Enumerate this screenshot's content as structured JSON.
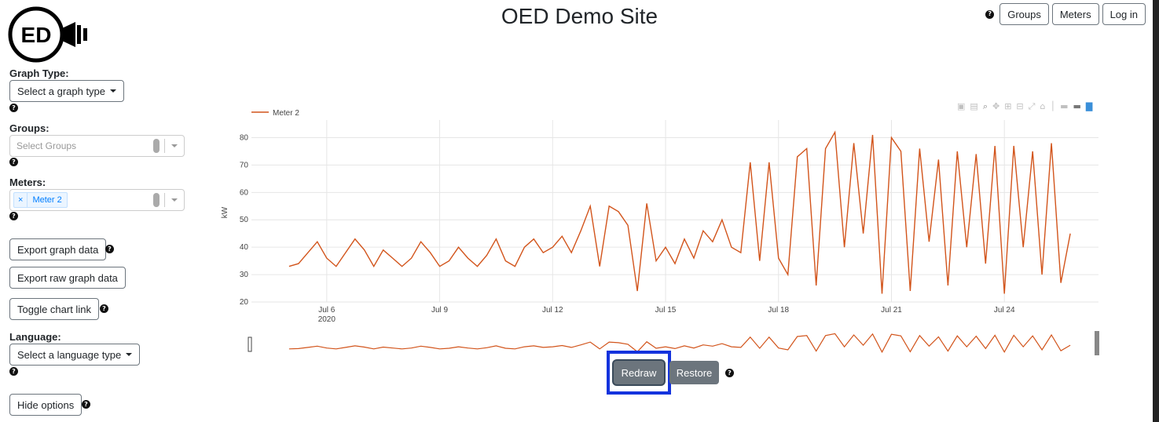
{
  "header": {
    "title": "OED Demo Site",
    "logo_text": "ED",
    "help": "?",
    "nav": [
      "Groups",
      "Meters",
      "Log in"
    ]
  },
  "sidebar": {
    "graph_type_label": "Graph Type:",
    "graph_type_value": "Select a graph type",
    "groups_label": "Groups:",
    "groups_placeholder": "Select Groups",
    "meters_label": "Meters:",
    "meters_selected": [
      "Meter 2"
    ],
    "chip_remove": "×",
    "export_graph": "Export graph data",
    "export_raw": "Export raw graph data",
    "toggle_link": "Toggle chart link",
    "language_label": "Language:",
    "language_value": "Select a language type",
    "hide_options": "Hide options"
  },
  "chart_controls": {
    "redraw": "Redraw",
    "restore": "Restore"
  },
  "colors": {
    "series": "#d2541b",
    "highlight": "#1433dd",
    "button_secondary": "#6c757d"
  },
  "chart_data": {
    "type": "line",
    "ylabel": "kW",
    "ylim": [
      20,
      83
    ],
    "yticks": [
      20,
      30,
      40,
      50,
      60,
      70,
      80
    ],
    "xticks": [
      "Jul 6",
      "Jul 9",
      "Jul 12",
      "Jul 15",
      "Jul 18",
      "Jul 21",
      "Jul 24"
    ],
    "xtick_sublabel": "2020",
    "x_start": "2020-07-04",
    "x_end": "2020-07-26",
    "legend": "top-left",
    "grid": true,
    "series": [
      {
        "name": "Meter 2",
        "color": "#d2541b",
        "points": [
          [
            "2020-07-05 00:00",
            33
          ],
          [
            "2020-07-05 06:00",
            34
          ],
          [
            "2020-07-05 12:00",
            38
          ],
          [
            "2020-07-05 18:00",
            42
          ],
          [
            "2020-07-06 00:00",
            36
          ],
          [
            "2020-07-06 06:00",
            33
          ],
          [
            "2020-07-06 12:00",
            38
          ],
          [
            "2020-07-06 18:00",
            43
          ],
          [
            "2020-07-07 00:00",
            39
          ],
          [
            "2020-07-07 06:00",
            33
          ],
          [
            "2020-07-07 12:00",
            39
          ],
          [
            "2020-07-07 18:00",
            36
          ],
          [
            "2020-07-08 00:00",
            33
          ],
          [
            "2020-07-08 06:00",
            36
          ],
          [
            "2020-07-08 12:00",
            42
          ],
          [
            "2020-07-08 18:00",
            38
          ],
          [
            "2020-07-09 00:00",
            33
          ],
          [
            "2020-07-09 06:00",
            35
          ],
          [
            "2020-07-09 12:00",
            40
          ],
          [
            "2020-07-09 18:00",
            36
          ],
          [
            "2020-07-10 00:00",
            33
          ],
          [
            "2020-07-10 06:00",
            37
          ],
          [
            "2020-07-10 12:00",
            43
          ],
          [
            "2020-07-10 18:00",
            35
          ],
          [
            "2020-07-11 00:00",
            33
          ],
          [
            "2020-07-11 06:00",
            40
          ],
          [
            "2020-07-11 12:00",
            43
          ],
          [
            "2020-07-11 18:00",
            38
          ],
          [
            "2020-07-12 00:00",
            40
          ],
          [
            "2020-07-12 06:00",
            44
          ],
          [
            "2020-07-12 12:00",
            38
          ],
          [
            "2020-07-12 18:00",
            46
          ],
          [
            "2020-07-13 00:00",
            55
          ],
          [
            "2020-07-13 06:00",
            33
          ],
          [
            "2020-07-13 12:00",
            55
          ],
          [
            "2020-07-13 18:00",
            53
          ],
          [
            "2020-07-14 00:00",
            48
          ],
          [
            "2020-07-14 06:00",
            24
          ],
          [
            "2020-07-14 12:00",
            56
          ],
          [
            "2020-07-14 18:00",
            35
          ],
          [
            "2020-07-15 00:00",
            40
          ],
          [
            "2020-07-15 06:00",
            34
          ],
          [
            "2020-07-15 12:00",
            43
          ],
          [
            "2020-07-15 18:00",
            36
          ],
          [
            "2020-07-16 00:00",
            46
          ],
          [
            "2020-07-16 06:00",
            42
          ],
          [
            "2020-07-16 12:00",
            50
          ],
          [
            "2020-07-16 18:00",
            40
          ],
          [
            "2020-07-17 00:00",
            38
          ],
          [
            "2020-07-17 06:00",
            71
          ],
          [
            "2020-07-17 12:00",
            35
          ],
          [
            "2020-07-17 18:00",
            71
          ],
          [
            "2020-07-18 00:00",
            36
          ],
          [
            "2020-07-18 06:00",
            30
          ],
          [
            "2020-07-18 12:00",
            73
          ],
          [
            "2020-07-18 18:00",
            76
          ],
          [
            "2020-07-19 00:00",
            26
          ],
          [
            "2020-07-19 06:00",
            76
          ],
          [
            "2020-07-19 12:00",
            82
          ],
          [
            "2020-07-19 18:00",
            40
          ],
          [
            "2020-07-20 00:00",
            78
          ],
          [
            "2020-07-20 06:00",
            45
          ],
          [
            "2020-07-20 12:00",
            81
          ],
          [
            "2020-07-20 18:00",
            23
          ],
          [
            "2020-07-21 00:00",
            80
          ],
          [
            "2020-07-21 06:00",
            75
          ],
          [
            "2020-07-21 12:00",
            24
          ],
          [
            "2020-07-21 18:00",
            76
          ],
          [
            "2020-07-22 00:00",
            42
          ],
          [
            "2020-07-22 06:00",
            72
          ],
          [
            "2020-07-22 12:00",
            26
          ],
          [
            "2020-07-22 18:00",
            75
          ],
          [
            "2020-07-23 00:00",
            40
          ],
          [
            "2020-07-23 06:00",
            74
          ],
          [
            "2020-07-23 12:00",
            34
          ],
          [
            "2020-07-23 18:00",
            77
          ],
          [
            "2020-07-24 00:00",
            23
          ],
          [
            "2020-07-24 06:00",
            77
          ],
          [
            "2020-07-24 12:00",
            40
          ],
          [
            "2020-07-24 18:00",
            75
          ],
          [
            "2020-07-25 00:00",
            30
          ],
          [
            "2020-07-25 06:00",
            78
          ],
          [
            "2020-07-25 12:00",
            27
          ],
          [
            "2020-07-25 18:00",
            45
          ]
        ]
      }
    ]
  }
}
